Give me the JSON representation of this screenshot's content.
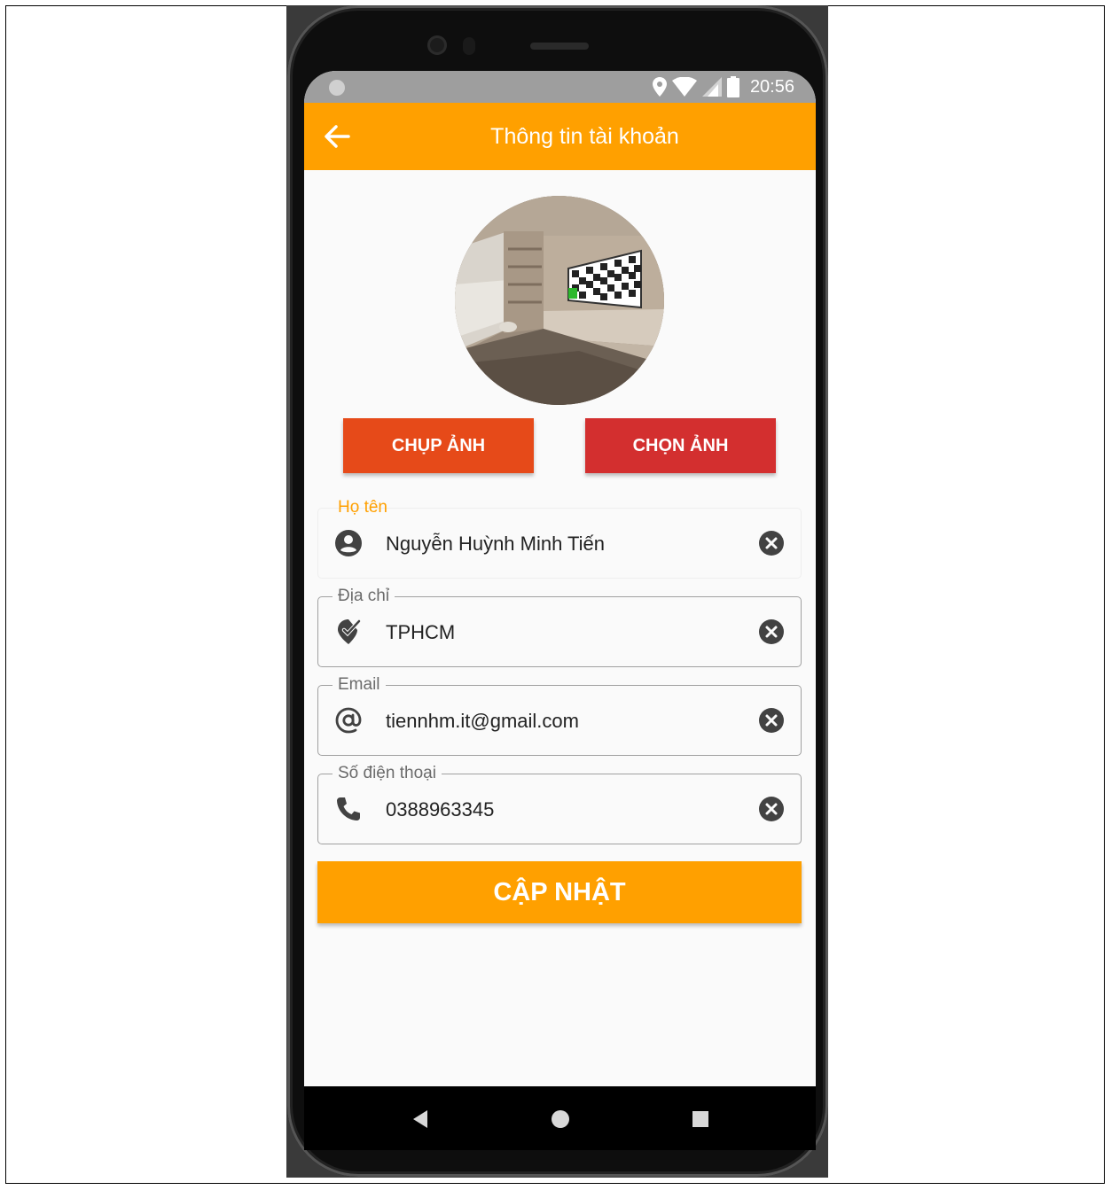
{
  "status_bar": {
    "time": "20:56",
    "icons": [
      "location-icon",
      "wifi-icon",
      "signal-icon",
      "battery-icon"
    ]
  },
  "app_bar": {
    "title": "Thông tin tài khoản",
    "back_icon": "arrow-left-icon"
  },
  "profile": {
    "avatar": "room-photo"
  },
  "actions": {
    "capture_label": "CHỤP ẢNH",
    "choose_label": "CHỌN ẢNH"
  },
  "form": {
    "name": {
      "label": "Họ tên",
      "value": "Nguyễn Huỳnh Minh Tiến",
      "icon": "account-circle-icon"
    },
    "address": {
      "label": "Địa chỉ",
      "value": "TPHCM",
      "icon": "location-check-icon"
    },
    "email": {
      "label": "Email",
      "value": "tiennhm.it@gmail.com",
      "icon": "at-icon"
    },
    "phone": {
      "label": "Số điện thoại",
      "value": "0388963345",
      "icon": "phone-icon"
    }
  },
  "update_label": "CẬP NHẬT",
  "colors": {
    "primary": "#ffa000",
    "capture_button": "#e64a19",
    "choose_button": "#d32f2f",
    "focused_label": "#ffa000"
  },
  "nav": [
    "back-triangle-icon",
    "home-circle-icon",
    "recents-square-icon"
  ]
}
